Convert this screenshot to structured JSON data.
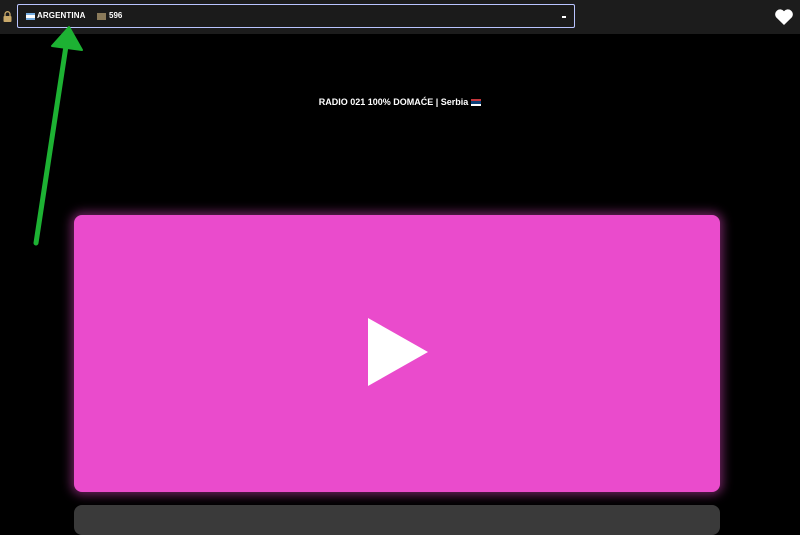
{
  "header": {
    "country_select": {
      "country": "ARGENTINA",
      "count": "596",
      "colors": {
        "border": "#b9c4ff",
        "background": "#1b1b1b"
      }
    },
    "icons": {
      "lock": "lock-icon",
      "heart": "heart-icon",
      "chevron": "chevron-down-icon"
    }
  },
  "station": {
    "title": "RADIO 021 100% DOMAĆE | Serbia"
  },
  "player": {
    "accent_color": "#ea4bcc",
    "icon": "play-icon"
  },
  "annotation": {
    "color": "#1db233",
    "type": "arrow"
  }
}
